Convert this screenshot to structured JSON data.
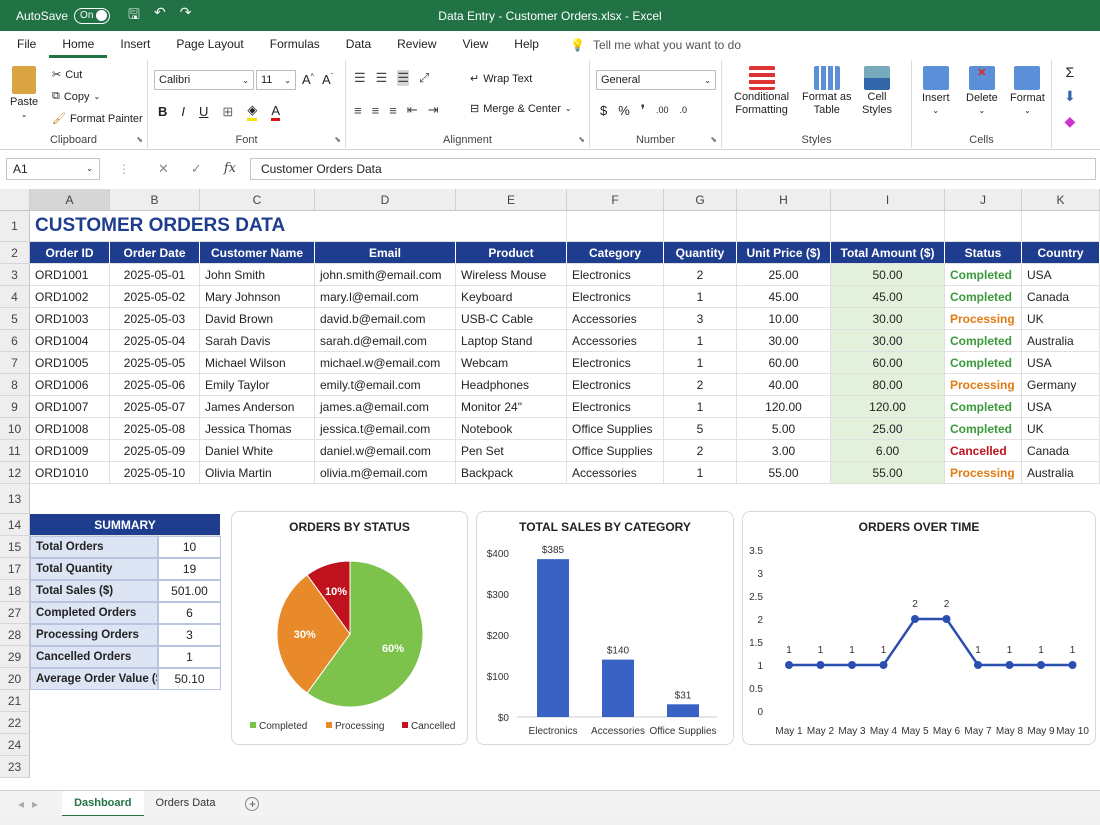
{
  "window": {
    "title": "Data Entry - Customer Orders.xlsx  -  Excel",
    "autosave_label": "AutoSave",
    "autosave_state": "On"
  },
  "menu": {
    "tabs": [
      "File",
      "Home",
      "Insert",
      "Page Layout",
      "Formulas",
      "Data",
      "Review",
      "View",
      "Help"
    ],
    "active": "Home",
    "tell_me": "Tell me what you want to do"
  },
  "ribbon": {
    "clipboard": {
      "label": "Clipboard",
      "paste": "Paste",
      "cut": "Cut",
      "copy": "Copy",
      "format_painter": "Format Painter"
    },
    "font": {
      "label": "Font",
      "family": "Calibri",
      "size": "11"
    },
    "alignment": {
      "label": "Alignment",
      "wrap": "Wrap Text",
      "merge": "Merge & Center"
    },
    "number": {
      "label": "Number",
      "format": "General"
    },
    "styles": {
      "label": "Styles",
      "conditional": "Conditional",
      "conditional2": "Formatting",
      "format_table": "Format as",
      "format_table2": "Table",
      "cell_styles": "Cell",
      "cell_styles2": "Styles"
    },
    "cells": {
      "label": "Cells",
      "insert": "Insert",
      "delete": "Delete",
      "format": "Format"
    }
  },
  "formula_bar": {
    "name_box": "A1",
    "fx": "fx",
    "content": "Customer Orders Data"
  },
  "columns": [
    "A",
    "B",
    "C",
    "D",
    "E",
    "F",
    "G",
    "H",
    "I",
    "J",
    "K"
  ],
  "sheet": {
    "title": "CUSTOMER ORDERS DATA",
    "headers": [
      "Order ID",
      "Order Date",
      "Customer Name",
      "Email",
      "Product",
      "Category",
      "Quantity",
      "Unit Price ($)",
      "Total Amount ($)",
      "Status",
      "Country"
    ],
    "rows": [
      [
        "ORD1001",
        "2025-05-01",
        "John Smith",
        "john.smith@email.com",
        "Wireless Mouse",
        "Electronics",
        "2",
        "25.00",
        "50.00",
        "Completed",
        "USA"
      ],
      [
        "ORD1002",
        "2025-05-02",
        "Mary Johnson",
        "mary.l@email.com",
        "Keyboard",
        "Electronics",
        "1",
        "45.00",
        "45.00",
        "Completed",
        "Canada"
      ],
      [
        "ORD1003",
        "2025-05-03",
        "David Brown",
        "david.b@email.com",
        "USB-C Cable",
        "Accessories",
        "3",
        "10.00",
        "30.00",
        "Processing",
        "UK"
      ],
      [
        "ORD1004",
        "2025-05-04",
        "Sarah Davis",
        "sarah.d@email.com",
        "Laptop Stand",
        "Accessories",
        "1",
        "30.00",
        "30.00",
        "Completed",
        "Australia"
      ],
      [
        "ORD1005",
        "2025-05-05",
        "Michael Wilson",
        "michael.w@email.com",
        "Webcam",
        "Electronics",
        "1",
        "60.00",
        "60.00",
        "Completed",
        "USA"
      ],
      [
        "ORD1006",
        "2025-05-06",
        "Emily Taylor",
        "emily.t@email.com",
        "Headphones",
        "Electronics",
        "2",
        "40.00",
        "80.00",
        "Processing",
        "Germany"
      ],
      [
        "ORD1007",
        "2025-05-07",
        "James Anderson",
        "james.a@email.com",
        "Monitor 24\"",
        "Electronics",
        "1",
        "120.00",
        "120.00",
        "Completed",
        "USA"
      ],
      [
        "ORD1008",
        "2025-05-08",
        "Jessica Thomas",
        "jessica.t@email.com",
        "Notebook",
        "Office Supplies",
        "5",
        "5.00",
        "25.00",
        "Completed",
        "UK"
      ],
      [
        "ORD1009",
        "2025-05-09",
        "Daniel White",
        "daniel.w@email.com",
        "Pen Set",
        "Office Supplies",
        "2",
        "3.00",
        "6.00",
        "Cancelled",
        "Canada"
      ],
      [
        "ORD1010",
        "2025-05-10",
        "Olivia Martin",
        "olivia.m@email.com",
        "Backpack",
        "Accessories",
        "1",
        "55.00",
        "55.00",
        "Processing",
        "Australia"
      ]
    ],
    "row_numbers": [
      "1",
      "2",
      "3",
      "4",
      "5",
      "6",
      "7",
      "8",
      "9",
      "10",
      "11",
      "12",
      "13",
      "14",
      "15",
      "17",
      "18",
      "27",
      "28",
      "29",
      "20",
      "21",
      "22",
      "24",
      "23"
    ],
    "status_colors": {
      "Completed": "#3a9a3a",
      "Processing": "#e07b12",
      "Cancelled": "#c0121c"
    }
  },
  "summary": {
    "title": "SUMMARY",
    "items": [
      {
        "label": "Total Orders",
        "value": "10"
      },
      {
        "label": "Total Quantity",
        "value": "19"
      },
      {
        "label": "Total Sales ($)",
        "value": "501.00"
      },
      {
        "label": "Completed Orders",
        "value": "6"
      },
      {
        "label": "Processing Orders",
        "value": "3"
      },
      {
        "label": "Cancelled Orders",
        "value": "1"
      },
      {
        "label": "Average Order Value ($)",
        "value": "50.10"
      }
    ]
  },
  "chart_data": [
    {
      "type": "pie",
      "title": "ORDERS BY STATUS",
      "categories": [
        "Completed",
        "Processing",
        "Cancelled"
      ],
      "values": [
        60,
        30,
        10
      ],
      "labels": [
        "60%",
        "30%",
        "10%"
      ],
      "colors": [
        "#7dc24b",
        "#e8892a",
        "#c0121c"
      ],
      "legend": "bottom"
    },
    {
      "type": "bar",
      "title": "TOTAL SALES BY CATEGORY",
      "categories": [
        "Electronics",
        "Accessories",
        "Office Supplies"
      ],
      "values": [
        385,
        140,
        31
      ],
      "labels": [
        "$385",
        "$140",
        "$31"
      ],
      "yticks": [
        "$0",
        "$100",
        "$200",
        "$300",
        "$400"
      ],
      "ylim": [
        0,
        400
      ],
      "color": "#3a62c4"
    },
    {
      "type": "line",
      "title": "ORDERS OVER TIME",
      "categories": [
        "May 1",
        "May 2",
        "May 3",
        "May 4",
        "May 5",
        "May 6",
        "May 7",
        "May 8",
        "May 9",
        "May 10"
      ],
      "values": [
        1,
        1,
        1,
        1,
        2,
        2,
        1,
        1,
        1,
        1
      ],
      "labels": [
        "1",
        "1",
        "1",
        "1",
        "2",
        "2",
        "1",
        "1",
        "1",
        "1"
      ],
      "yticks": [
        "0",
        "0.5",
        "1",
        "1.5",
        "2",
        "2.5",
        "3",
        "3.5"
      ],
      "ylim": [
        0,
        3.5
      ],
      "color": "#2a4fb0"
    }
  ],
  "sheet_tabs": [
    "Dashboard",
    "Orders Data"
  ],
  "active_sheet": "Dashboard"
}
